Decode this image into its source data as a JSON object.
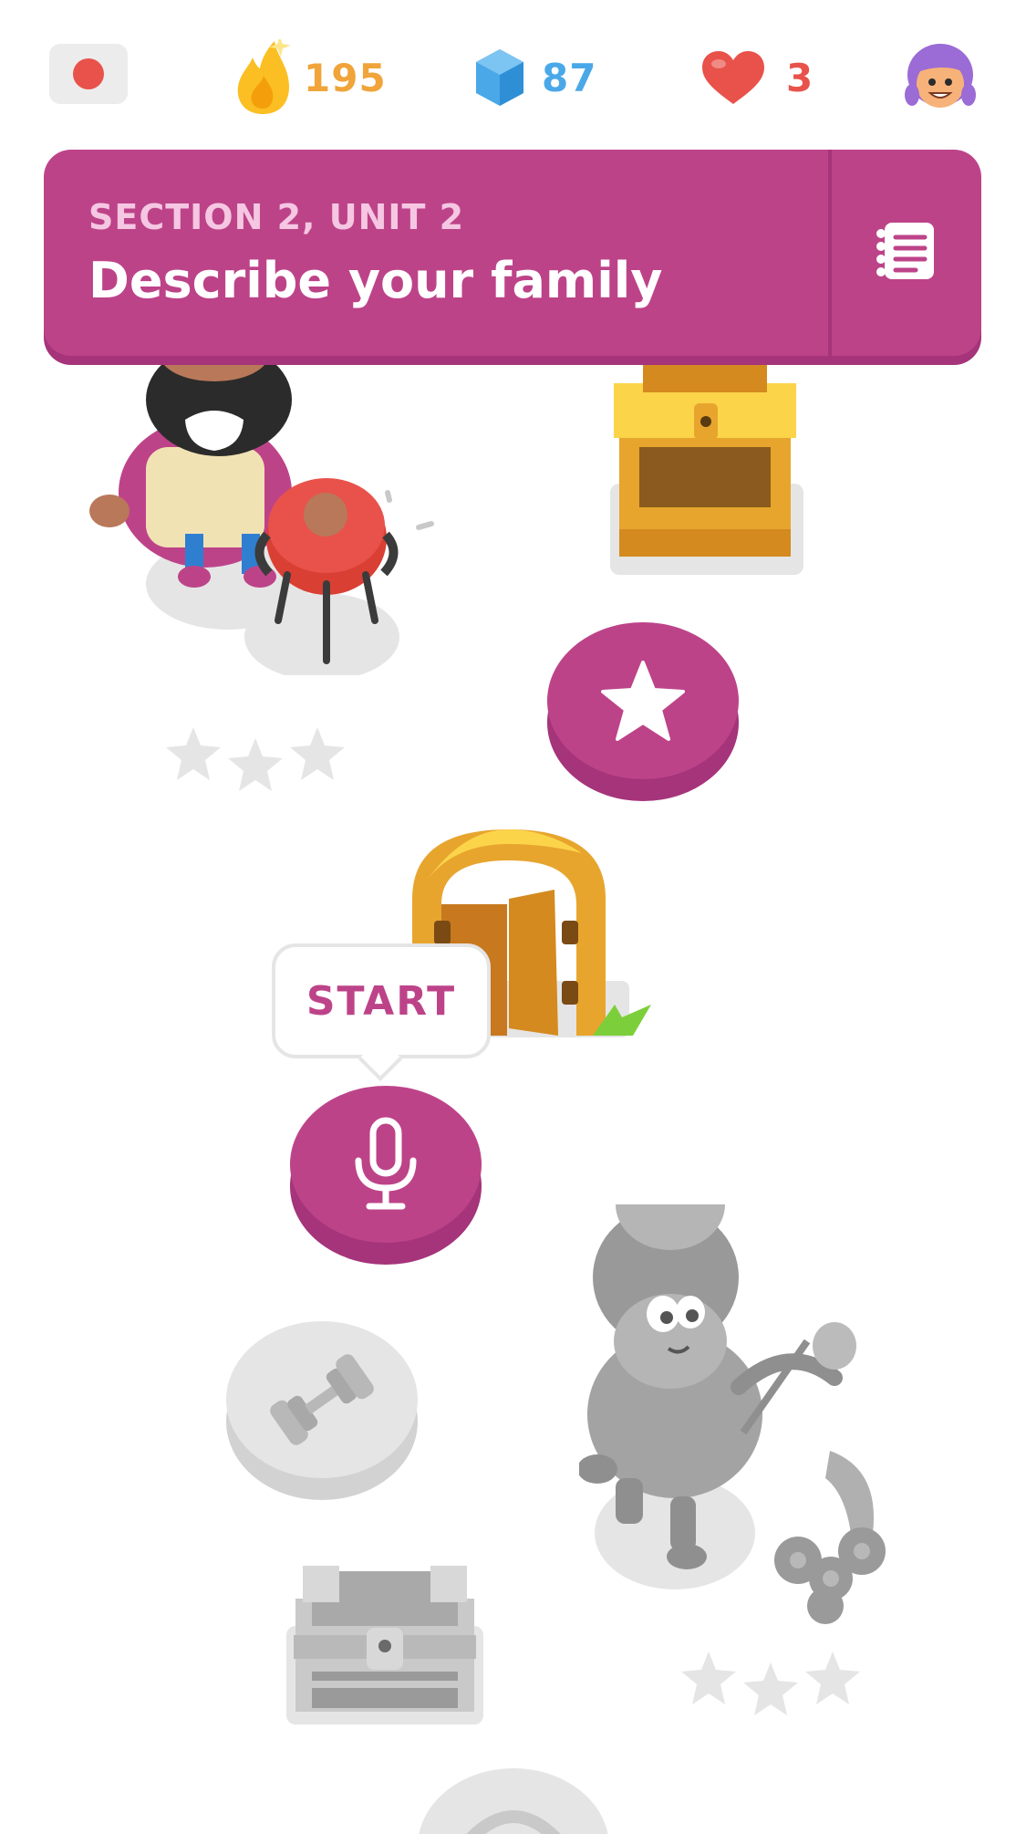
{
  "top_bar": {
    "language_flag": "japan-flag",
    "streak": "195",
    "gems": "87",
    "hearts": "3",
    "avatar": "avatar-icon"
  },
  "banner": {
    "section_label": "SECTION 2, UNIT 2",
    "unit_title": "Describe your family",
    "guidebook_icon": "notebook-icon"
  },
  "path": {
    "start_label": "START",
    "nodes": [
      {
        "type": "chest",
        "state": "unlocked"
      },
      {
        "type": "star",
        "state": "completed"
      },
      {
        "type": "door",
        "state": "unlocked"
      },
      {
        "type": "microphone",
        "state": "current"
      },
      {
        "type": "practice",
        "state": "locked"
      },
      {
        "type": "chest",
        "state": "locked"
      }
    ]
  },
  "colors": {
    "accent": "#bd4389",
    "accent_dark": "#a5347a",
    "streak": "#f0a43a",
    "gems": "#4aa8e8",
    "hearts": "#e8524a",
    "locked": "#e5e5e5"
  }
}
